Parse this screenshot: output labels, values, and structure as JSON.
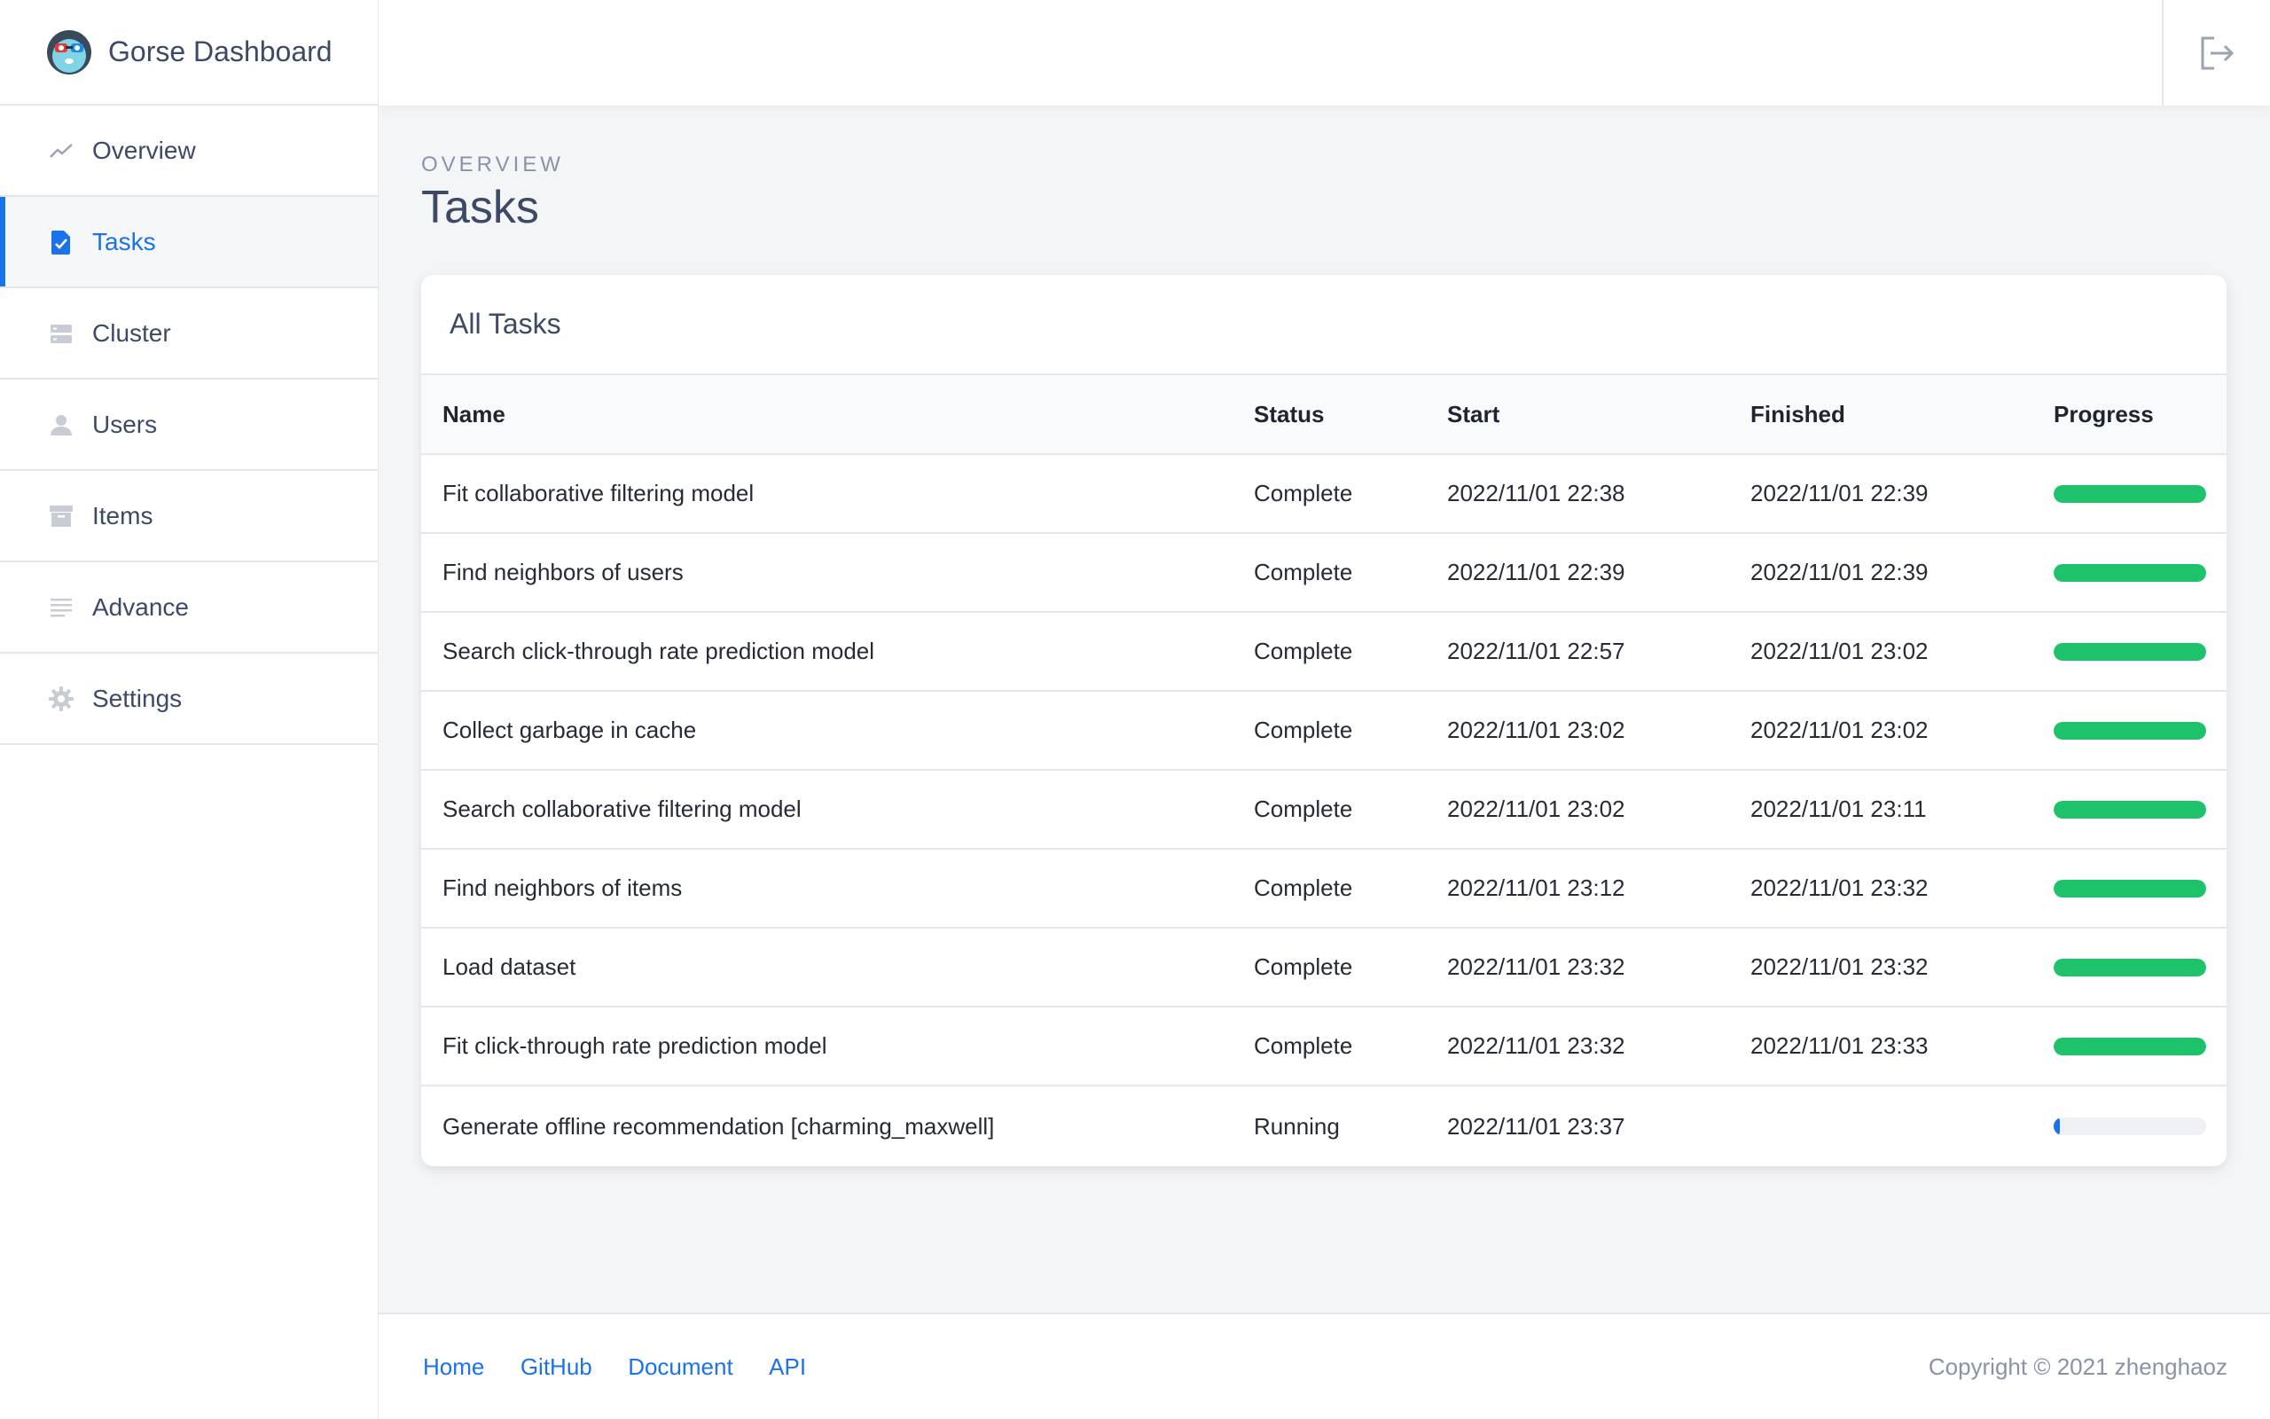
{
  "brand": {
    "title": "Gorse Dashboard"
  },
  "sidebar": {
    "items": [
      {
        "label": "Overview",
        "icon": "trending-line-icon",
        "active": false
      },
      {
        "label": "Tasks",
        "icon": "file-check-icon",
        "active": true
      },
      {
        "label": "Cluster",
        "icon": "server-icon",
        "active": false
      },
      {
        "label": "Users",
        "icon": "user-icon",
        "active": false
      },
      {
        "label": "Items",
        "icon": "archive-icon",
        "active": false
      },
      {
        "label": "Advance",
        "icon": "lines-icon",
        "active": false
      },
      {
        "label": "Settings",
        "icon": "gear-icon",
        "active": false
      }
    ]
  },
  "topbar": {
    "logout_icon": "logout-icon"
  },
  "page": {
    "eyebrow": "OVERVIEW",
    "title": "Tasks"
  },
  "card": {
    "title": "All Tasks",
    "columns": [
      "Name",
      "Status",
      "Start",
      "Finished",
      "Progress"
    ],
    "rows": [
      {
        "name": "Fit collaborative filtering model",
        "status": "Complete",
        "start": "2022/11/01 22:38",
        "finished": "2022/11/01 22:39",
        "progress": 1.0
      },
      {
        "name": "Find neighbors of users",
        "status": "Complete",
        "start": "2022/11/01 22:39",
        "finished": "2022/11/01 22:39",
        "progress": 1.0
      },
      {
        "name": "Search click-through rate prediction model",
        "status": "Complete",
        "start": "2022/11/01 22:57",
        "finished": "2022/11/01 23:02",
        "progress": 1.0
      },
      {
        "name": "Collect garbage in cache",
        "status": "Complete",
        "start": "2022/11/01 23:02",
        "finished": "2022/11/01 23:02",
        "progress": 1.0
      },
      {
        "name": "Search collaborative filtering model",
        "status": "Complete",
        "start": "2022/11/01 23:02",
        "finished": "2022/11/01 23:11",
        "progress": 1.0
      },
      {
        "name": "Find neighbors of items",
        "status": "Complete",
        "start": "2022/11/01 23:12",
        "finished": "2022/11/01 23:32",
        "progress": 1.0
      },
      {
        "name": "Load dataset",
        "status": "Complete",
        "start": "2022/11/01 23:32",
        "finished": "2022/11/01 23:32",
        "progress": 1.0
      },
      {
        "name": "Fit click-through rate prediction model",
        "status": "Complete",
        "start": "2022/11/01 23:32",
        "finished": "2022/11/01 23:33",
        "progress": 1.0
      },
      {
        "name": "Generate offline recommendation [charming_maxwell]",
        "status": "Running",
        "start": "2022/11/01 23:37",
        "finished": "",
        "progress": 0.04
      }
    ]
  },
  "colors": {
    "accent": "#1a73e8",
    "complete": "#1dc26a",
    "running": "#1a73e8"
  },
  "footer": {
    "links": [
      "Home",
      "GitHub",
      "Document",
      "API"
    ],
    "copyright": "Copyright © 2021 zhenghaoz"
  }
}
